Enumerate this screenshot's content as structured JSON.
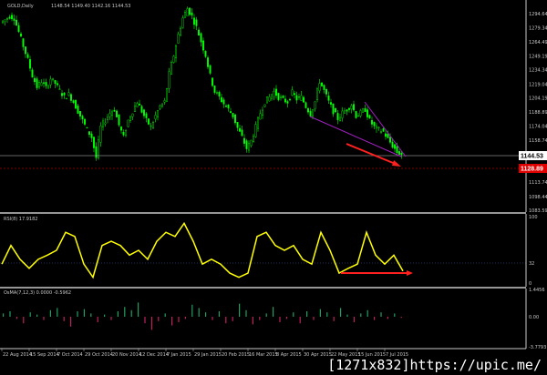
{
  "main": {
    "title": "GOLD,Daily",
    "ohlc": "1148.54 1149.40 1142.16 1144.53",
    "price_labels": [
      "1294.64",
      "1279.34",
      "1264.49",
      "1249.19",
      "1234.34",
      "1219.04",
      "1204.19",
      "1188.89",
      "1174.04",
      "1158.74",
      "1113.74",
      "1098.44",
      "1083.59"
    ],
    "current_price": "1144.53",
    "ask_price": "1128.89",
    "colors": {
      "candle": "#00ff00",
      "trendline": "#a020c0",
      "arrow": "#ff2020",
      "bid_line": "#c8c8c8",
      "ask_line": "#ff0000"
    },
    "closes": [
      1285,
      1288,
      1292,
      1290,
      1275,
      1260,
      1245,
      1228,
      1216,
      1222,
      1215,
      1225,
      1220,
      1212,
      1205,
      1208,
      1200,
      1190,
      1180,
      1170,
      1162,
      1140,
      1173,
      1180,
      1188,
      1192,
      1175,
      1162,
      1180,
      1190,
      1200,
      1190,
      1180,
      1173,
      1185,
      1195,
      1200,
      1230,
      1250,
      1272,
      1290,
      1300,
      1292,
      1280,
      1265,
      1250,
      1228,
      1211,
      1205,
      1198,
      1192,
      1185,
      1172,
      1162,
      1150,
      1158,
      1173,
      1188,
      1200,
      1205,
      1211,
      1205,
      1202,
      1200,
      1210,
      1203,
      1205,
      1195,
      1187,
      1200,
      1222,
      1212,
      1200,
      1190,
      1182,
      1188,
      1192,
      1197,
      1185,
      1188,
      1192,
      1180,
      1173,
      1170,
      1168,
      1160,
      1153,
      1146,
      1144
    ]
  },
  "rsi": {
    "title": "RSI(8) 17.9182",
    "labels": {
      "top": "100",
      "level": "32",
      "bottom": "0"
    },
    "level": 32,
    "color": "#ffff00",
    "values": [
      30,
      57,
      37,
      24,
      37,
      43,
      50,
      76,
      70,
      30,
      11,
      57,
      63,
      57,
      43,
      50,
      37,
      63,
      76,
      70,
      89,
      63,
      30,
      37,
      30,
      17,
      11,
      17,
      70,
      76,
      57,
      50,
      57,
      37,
      30,
      76,
      50,
      17,
      24,
      30,
      76,
      43,
      30,
      43,
      20
    ]
  },
  "osma": {
    "title": "OsMA(7,12,3) 0.0000 -0.5962",
    "labels": {
      "top": "1.4456",
      "zero": "0.00",
      "bottom": "-3.7793"
    },
    "values": [
      0.3,
      0.5,
      -0.2,
      -0.6,
      0.4,
      0.2,
      -0.3,
      0.6,
      0.8,
      -0.4,
      -0.9,
      0.5,
      0.7,
      0.3,
      -0.5,
      0.2,
      -0.3,
      0.5,
      0.9,
      0.6,
      1.3,
      -0.6,
      -1.2,
      -0.4,
      0.3,
      -0.8,
      -0.5,
      -0.2,
      1.1,
      0.8,
      0.4,
      -0.3,
      0.5,
      -0.6,
      -0.4,
      1.2,
      0.6,
      -0.7,
      -0.3,
      0.3,
      0.9,
      -0.5,
      -0.2,
      0.4,
      -0.6,
      0.5,
      -0.3,
      0.7,
      0.4,
      -0.4,
      0.8,
      0.2,
      -0.5,
      0.3,
      0.6,
      -0.3,
      0.4,
      -0.2,
      0.3,
      -0.1
    ]
  },
  "time_axis": [
    "22 Aug 2014",
    "15 Sep 2014",
    "7 Oct 2014",
    "29 Oct 2014",
    "20 Nov 2014",
    "12 Dec 2014",
    "7 Jan 2015",
    "29 Jan 2015",
    "20 Feb 2015",
    "16 Mar 2015",
    "8 Apr 2015",
    "30 Apr 2015",
    "22 May 2015",
    "15 Jun 2015",
    "7 Jul 2015"
  ],
  "watermark": "[1271x832]https://upic.me/"
}
